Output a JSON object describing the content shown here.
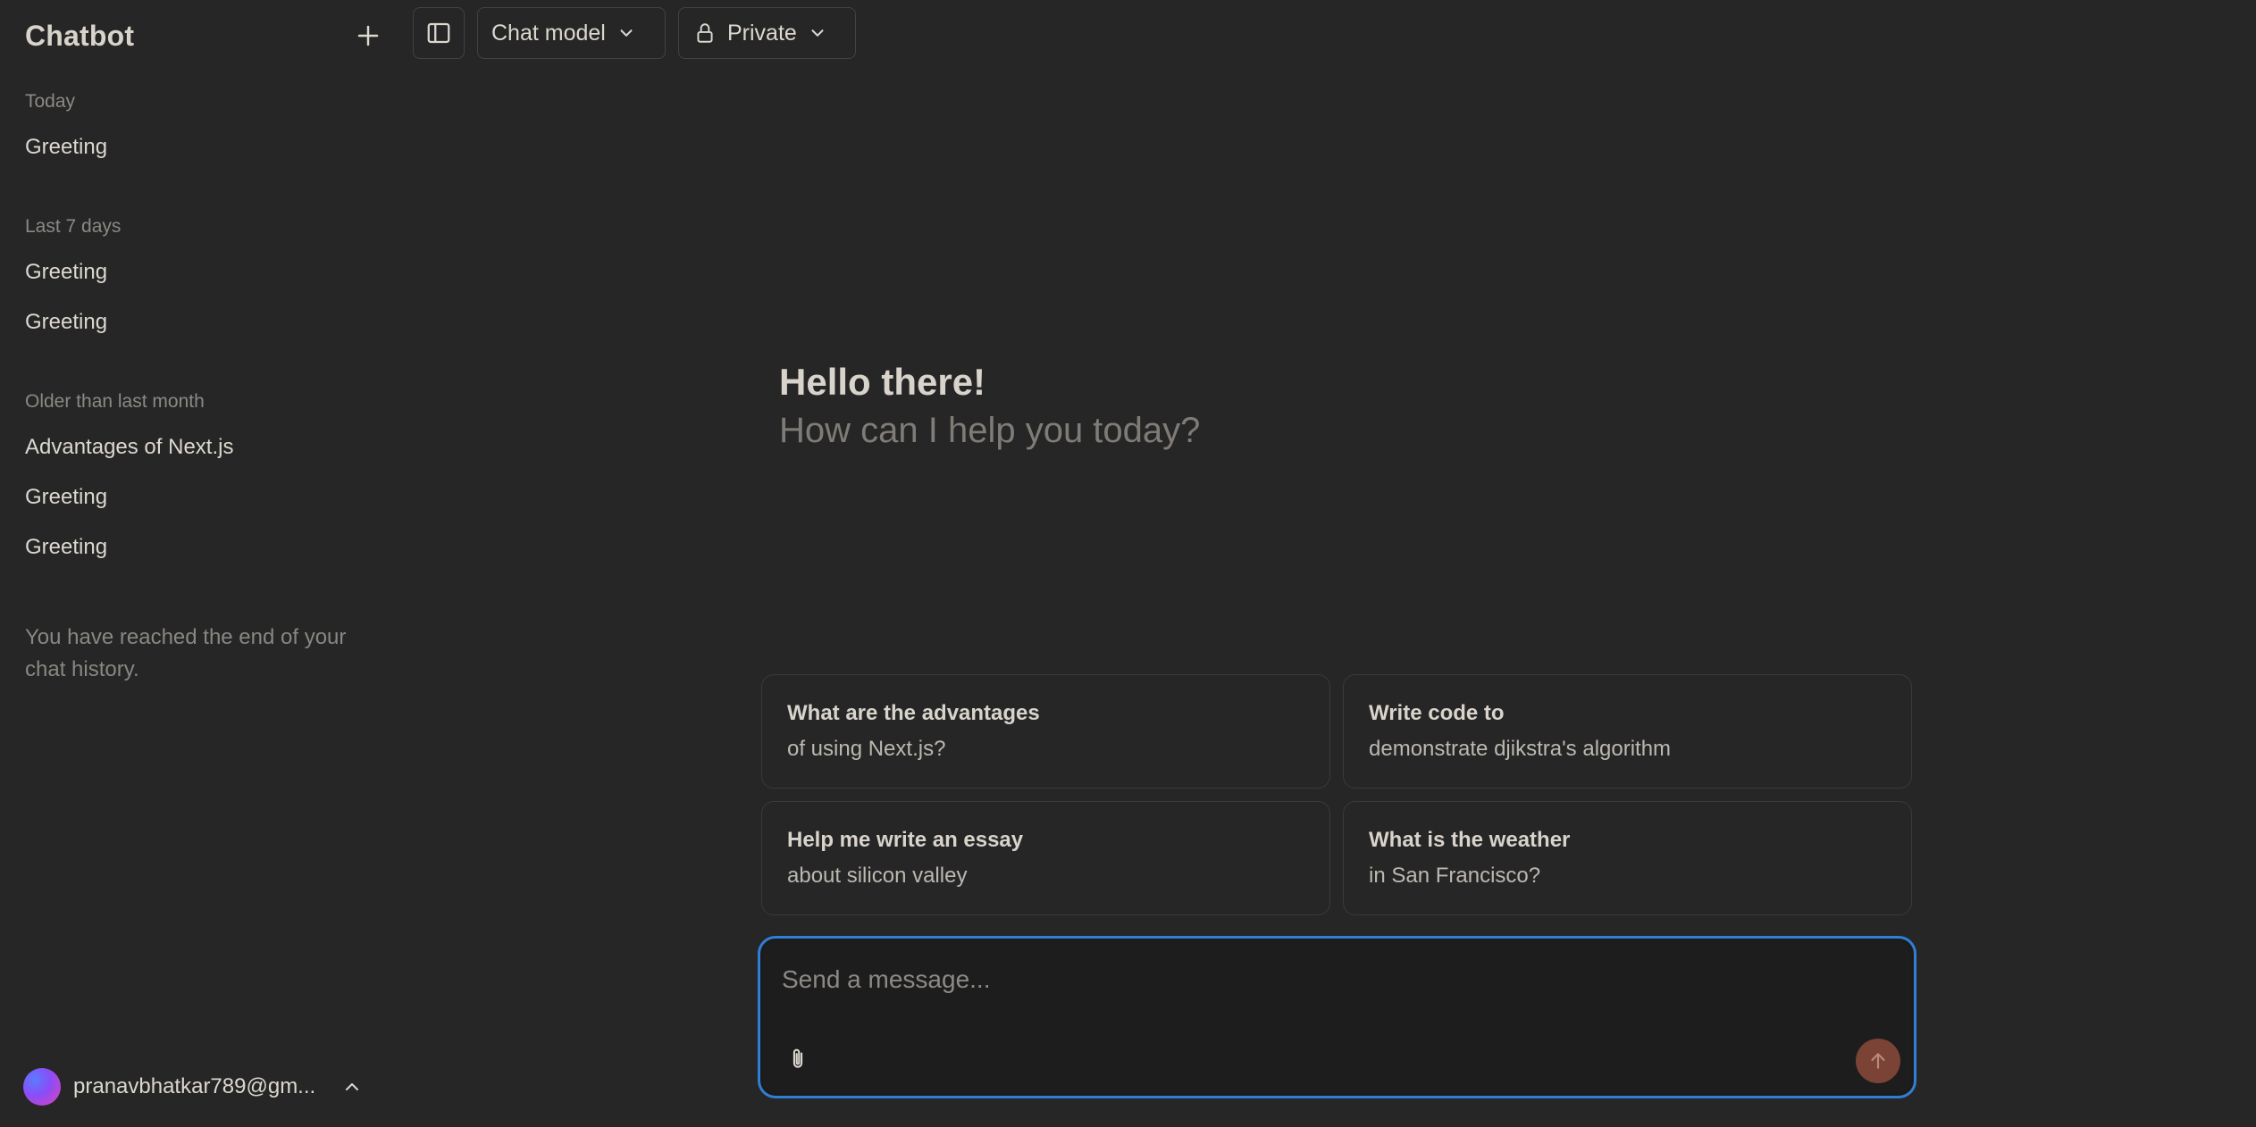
{
  "sidebar": {
    "app_title": "Chatbot",
    "new_chat_icon": "plus-icon",
    "sections": [
      {
        "label": "Today",
        "items": [
          "Greeting"
        ]
      },
      {
        "label": "Last 7 days",
        "items": [
          "Greeting",
          "Greeting"
        ]
      },
      {
        "label": "Older than last month",
        "items": [
          "Advantages of Next.js",
          "Greeting",
          "Greeting"
        ]
      }
    ],
    "end_note": "You have reached the end of your chat history.",
    "user": {
      "email": "pranavbhatkar789@gm...",
      "avatar_gradient": [
        "#5b7bff",
        "#8b4cf7",
        "#e244b8"
      ]
    }
  },
  "toolbar": {
    "sidebar_toggle_icon": "sidebar-toggle-icon",
    "model_label": "Chat model",
    "visibility_label": "Private",
    "visibility_icon": "lock-icon"
  },
  "greeting": {
    "title": "Hello there!",
    "subtitle": "How can I help you today?"
  },
  "suggestions": [
    {
      "line1": "What are the advantages",
      "line2": "of using Next.js?"
    },
    {
      "line1": "Write code to",
      "line2": "demonstrate djikstra's algorithm"
    },
    {
      "line1": "Help me write an essay",
      "line2": "about silicon valley"
    },
    {
      "line1": "What is the weather",
      "line2": "in San Francisco?"
    }
  ],
  "composer": {
    "placeholder": "Send a message...",
    "value": "",
    "attach_icon": "paperclip-icon",
    "send_icon": "arrow-up-icon"
  },
  "colors": {
    "background": "#262626",
    "focus_ring": "#2f7fd6",
    "send_button": "#7a4335"
  }
}
